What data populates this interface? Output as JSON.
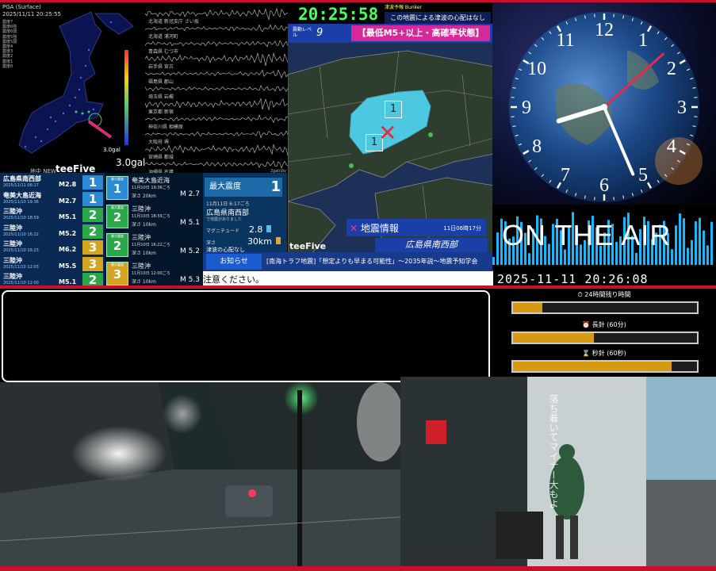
{
  "pga": {
    "title": "PGA (Surface)",
    "timestamp": "2025/11/11 20:25:55",
    "legend": [
      "震度7",
      "震度6強",
      "震度6弱",
      "震度5強",
      "震度5弱",
      "震度4",
      "震度3",
      "震度2",
      "震度1",
      "震度0"
    ],
    "scale_label": "PGA(gal)",
    "small_gal": "3.0gal",
    "gal": "3.0gal",
    "new_label": "地中 NEW",
    "brand": "teeFive"
  },
  "waveform": {
    "stations": [
      "北海道 新冠支庁 さい坂",
      "北海道 浦河町",
      "青森県 むつ市",
      "岩手県 宮古",
      "福島県 郡山",
      "埼玉県 岩槻",
      "東京都 新宿",
      "神奈川県 相模原",
      "大阪府 堺",
      "宮崎県 都城",
      "沖縄県 名護"
    ],
    "scale": "2gal/div"
  },
  "eq_list": [
    {
      "name": "広島県南西部",
      "date": "2025/11/11 06:17",
      "mag": "M2.8",
      "intensity": "1",
      "color": "#2b8ad6"
    },
    {
      "name": "奄美大島近海",
      "date": "2025/11/10 19:36",
      "mag": "M2.7",
      "intensity": "1",
      "color": "#2b8ad6"
    },
    {
      "name": "三陸沖",
      "date": "2025/11/10 18:59",
      "mag": "M5.1",
      "intensity": "2",
      "color": "#2aa84a"
    },
    {
      "name": "三陸沖",
      "date": "2025/11/10 16:22",
      "mag": "M5.2",
      "intensity": "2",
      "color": "#2aa84a"
    },
    {
      "name": "三陸沖",
      "date": "2025/11/10 16:23",
      "mag": "M6.2",
      "intensity": "3",
      "color": "#d4a520"
    },
    {
      "name": "三陸沖",
      "date": "2025/11/10 12:03",
      "mag": "M5.5",
      "intensity": "3",
      "color": "#d4a520"
    },
    {
      "name": "三陸沖",
      "date": "2025/11/10 12:00",
      "mag": "M5.1",
      "intensity": "2",
      "color": "#2aa84a"
    }
  ],
  "mid_list": [
    {
      "box_label": "最大震度",
      "box_val": "1",
      "box_color": "#2b8ad6",
      "place": "奄美大島近海",
      "time": "11月10日 19:36ごろ",
      "depth": "深さ 20km",
      "mag": "M 2.7"
    },
    {
      "box_label": "最大震度",
      "box_val": "2",
      "box_color": "#2aa84a",
      "place": "三陸沖",
      "time": "11月10日 18:59ごろ",
      "depth": "深さ 10km",
      "mag": "M 5.1"
    },
    {
      "box_label": "最大震度",
      "box_val": "2",
      "box_color": "#2aa84a",
      "place": "三陸沖",
      "time": "11月10日 16:22ごろ",
      "depth": "深さ 10km",
      "mag": "M 5.2"
    },
    {
      "box_label": "最大震度",
      "box_val": "3",
      "box_color": "#d4a520",
      "place": "三陸沖",
      "time": "11月10日 12:00ごろ",
      "depth": "深さ 10km",
      "mag": "M 5.3"
    }
  ],
  "detail": {
    "max_label": "最大震度",
    "max_value": "1",
    "time": "11月11日 6:17ごろ",
    "place": "広島県南西部",
    "sub": "で地震がありました",
    "mag_label": "マグニチュード",
    "mag": "2.8",
    "depth_label": "深さ",
    "depth": "30km",
    "tsunami": "津波の心配なし"
  },
  "topbar": {
    "time": "20:25:58",
    "tsunami_head": "津波予報 Bunker",
    "tsunami_msg": "この地震による津波の心配はなし",
    "level_label": "震動レベル",
    "level": "9",
    "mode": "【最低M5+以上・高確率状態】"
  },
  "map": {
    "title": "地震情報",
    "time": "11日06時17分",
    "place": "広島県南西部",
    "intensity_marks": [
      "1",
      "1"
    ],
    "brand": "teeFive"
  },
  "ticker": {
    "label": "お知らせ",
    "text": "[南海トラフ地震]「想定よりも早まる可能性」～2035年説～地震予知学会"
  },
  "caution": "注意ください。",
  "clock": {
    "numbers": [
      "12",
      "1",
      "2",
      "3",
      "4",
      "5",
      "6",
      "7",
      "8",
      "9",
      "10",
      "11"
    ],
    "hour": 8,
    "minute": 26,
    "second": 8
  },
  "onair": "ON THE AIR",
  "datetime": "2025-11-11 20:26:08",
  "progress": [
    {
      "label": "⏱ 24時間残り時間",
      "fraction": 0.16
    },
    {
      "label": "⏰ 長針 (60分)",
      "fraction": 0.44
    },
    {
      "label": "⌛ 秒針 (60秒)",
      "fraction": 0.86
    }
  ],
  "cam2_caption": "落ち着いてマイナー大もよ"
}
